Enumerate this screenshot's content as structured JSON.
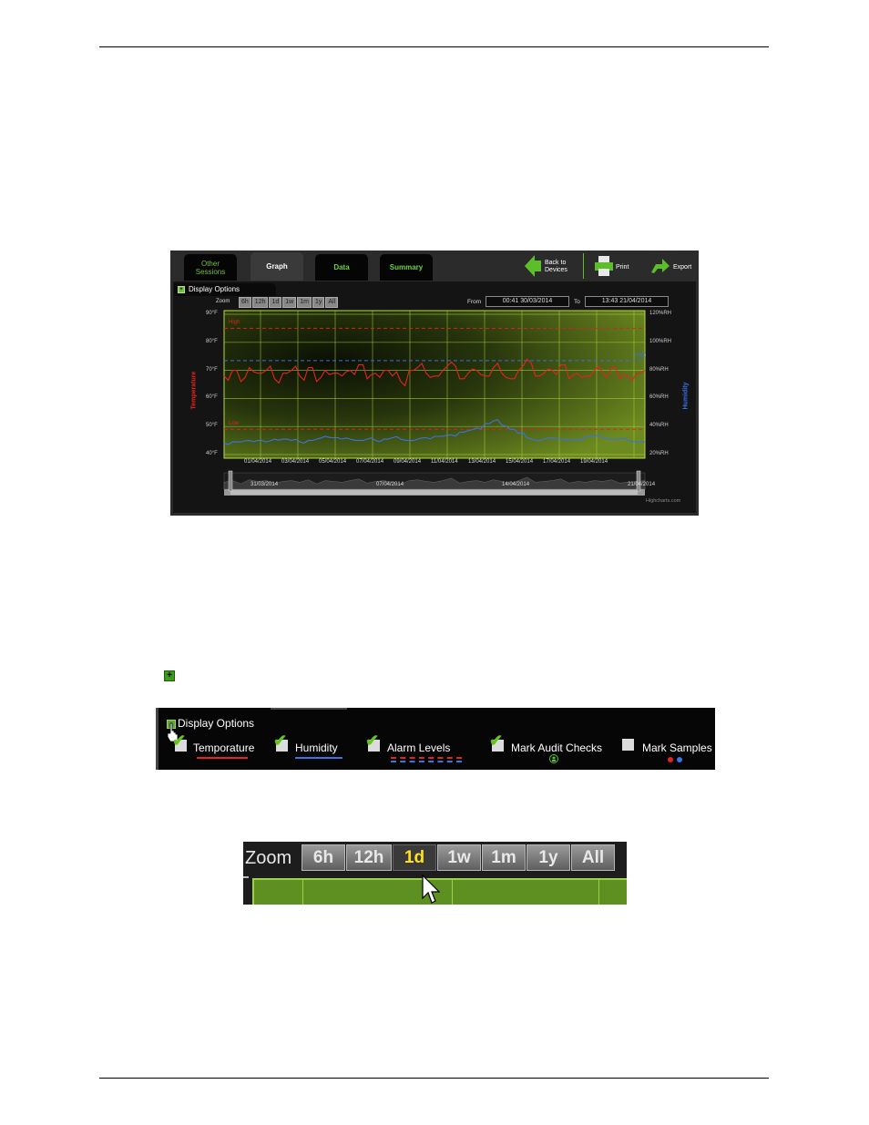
{
  "shot1": {
    "tabs": [
      {
        "label": "Other\nSessions",
        "active": false
      },
      {
        "label": "Graph",
        "active": true
      },
      {
        "label": "Data",
        "active": false
      },
      {
        "label": "Summary",
        "active": false
      }
    ],
    "toolbar": {
      "back_label": "Back to\nDevices",
      "print_label": "Print",
      "export_label": "Export"
    },
    "display_options": "Display Options",
    "zoom_label": "Zoom",
    "zoom_buttons": [
      "6h",
      "12h",
      "1d",
      "1w",
      "1m",
      "1y",
      "All"
    ],
    "from_label": "From",
    "from_value": "00:41  30/03/2014",
    "to_label": "To",
    "to_value": "13:43  21/04/2014",
    "credit": "Highcharts.com"
  },
  "chart_data": {
    "type": "line",
    "title": "",
    "left_axis_title": "Temperature",
    "right_axis_title": "Humidity",
    "left_ticks": [
      "90°F",
      "80°F",
      "70°F",
      "60°F",
      "50°F",
      "40°F"
    ],
    "right_ticks": [
      "120%RH",
      "100%RH",
      "80%RH",
      "60%RH",
      "40%RH",
      "20%RH"
    ],
    "x_ticks": [
      "01/04/2014",
      "03/04/2014",
      "05/04/2014",
      "07/04/2014",
      "09/04/2014",
      "11/04/2014",
      "13/04/2014",
      "15/04/2014",
      "17/04/2014",
      "19/04/2014"
    ],
    "navigator_ticks": [
      "31/03/2014",
      "07/04/2014",
      "14/04/2014",
      "21/04/2014"
    ],
    "alarm_levels": [
      {
        "label": "High",
        "value": 85,
        "axis": "temperature",
        "color": "#e02020"
      },
      {
        "label": "Low",
        "value": 49,
        "axis": "temperature",
        "color": "#e02020"
      },
      {
        "label": "High",
        "value": 87,
        "axis": "humidity",
        "color": "#3a6de8"
      }
    ],
    "series": [
      {
        "name": "Temperature",
        "color": "#e8231d",
        "axis": "temperature",
        "values": [
          68,
          70,
          66,
          71,
          69,
          70,
          67,
          69,
          70,
          68,
          71,
          66,
          70,
          69,
          68,
          70,
          72,
          67,
          69,
          70,
          68,
          66,
          70,
          71,
          69,
          68,
          70,
          73,
          67,
          69,
          70,
          68,
          71,
          69,
          67,
          70,
          74,
          68,
          69,
          70,
          72,
          67,
          69,
          68,
          70,
          69,
          71,
          67,
          68,
          69,
          70
        ]
      },
      {
        "name": "Humidity",
        "color": "#3a72e8",
        "axis": "humidity",
        "values": [
          28,
          29,
          29,
          30,
          30,
          29,
          31,
          31,
          30,
          29,
          30,
          31,
          33,
          32,
          31,
          31,
          30,
          31,
          30,
          31,
          32,
          31,
          30,
          31,
          32,
          33,
          33,
          34,
          36,
          37,
          39,
          42,
          44,
          41,
          38,
          35,
          32,
          30,
          31,
          32,
          31,
          30,
          31,
          33,
          33,
          32,
          31,
          31,
          30,
          29,
          29
        ]
      }
    ],
    "ylim_temperature": [
      40,
      90
    ],
    "ylim_humidity": [
      20,
      120
    ],
    "grid": true,
    "legend": "none"
  },
  "shot2": {
    "title": "Display Options",
    "options": [
      {
        "label": "Temporature",
        "checked": true,
        "color": "#e8231d"
      },
      {
        "label": "Humidity",
        "checked": true,
        "color": "#3a72e8"
      },
      {
        "label": "Alarm Levels",
        "checked": true
      },
      {
        "label": "Mark Audit Checks",
        "checked": true
      },
      {
        "label": "Mark Samples",
        "checked": false
      }
    ]
  },
  "shot3": {
    "zoom_label": "Zoom",
    "buttons": [
      "6h",
      "12h",
      "1d",
      "1w",
      "1m",
      "1y",
      "All"
    ],
    "selected": "1d"
  },
  "icons": [
    "plus-icon",
    "back-arrow-icon",
    "printer-icon",
    "export-arrow-icon",
    "hand-cursor-icon",
    "arrow-cursor-icon",
    "audit-check-icon"
  ]
}
